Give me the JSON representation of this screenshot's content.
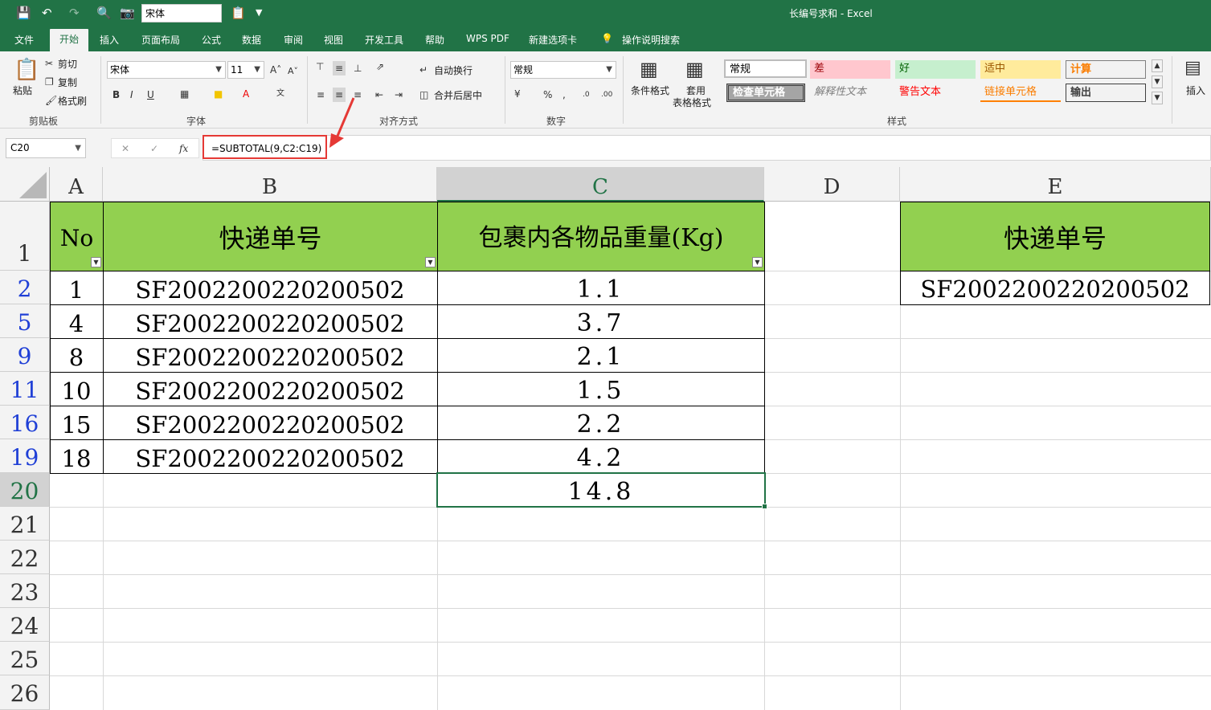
{
  "quick_access": {
    "font_value": "宋体"
  },
  "window_title": "长编号求和  -  Excel",
  "menu": {
    "tabs": [
      "文件",
      "开始",
      "插入",
      "页面布局",
      "公式",
      "数据",
      "审阅",
      "视图",
      "开发工具",
      "帮助",
      "WPS PDF",
      "新建选项卡",
      "操作说明搜索"
    ]
  },
  "ribbon": {
    "clipboard": {
      "paste": "粘贴",
      "cut": "剪切",
      "copy": "复制",
      "format_painter": "格式刷",
      "label": "剪贴板"
    },
    "font": {
      "name": "宋体",
      "size": "11",
      "label": "字体",
      "bold": "B",
      "italic": "I",
      "underline": "U"
    },
    "alignment": {
      "wrap": "自动换行",
      "merge": "合并后居中",
      "label": "对齐方式"
    },
    "number": {
      "format": "常规",
      "label": "数字"
    },
    "styles": {
      "conditional": "条件格式",
      "table_line1": "套用",
      "table_line2": "表格格式",
      "label": "样式",
      "items": [
        "常规",
        "差",
        "好",
        "适中",
        "计算",
        "检查单元格",
        "解释性文本",
        "警告文本",
        "链接单元格",
        "输出"
      ]
    },
    "cells": {
      "insert": "插入"
    }
  },
  "formula_bar": {
    "name_box": "C20",
    "fx": "fx",
    "formula": "=SUBTOTAL(9,C2:C19)"
  },
  "columns": [
    "A",
    "B",
    "C",
    "D",
    "E"
  ],
  "rows": [
    "1",
    "2",
    "5",
    "9",
    "11",
    "16",
    "19",
    "20",
    "21",
    "22",
    "23",
    "24",
    "25",
    "26"
  ],
  "headers": {
    "a": "No",
    "b": "快递单号",
    "c": "包裹内各物品重量(Kg)",
    "e": "快递单号"
  },
  "data_rows": [
    {
      "no": "1",
      "tracking": "SF2002200220200502",
      "weight": "1.1"
    },
    {
      "no": "4",
      "tracking": "SF2002200220200502",
      "weight": "3.7"
    },
    {
      "no": "8",
      "tracking": "SF2002200220200502",
      "weight": "2.1"
    },
    {
      "no": "10",
      "tracking": "SF2002200220200502",
      "weight": "1.5"
    },
    {
      "no": "15",
      "tracking": "SF2002200220200502",
      "weight": "2.2"
    },
    {
      "no": "18",
      "tracking": "SF2002200220200502",
      "weight": "4.2"
    }
  ],
  "total": "14.8",
  "e_value": "SF2002200220200502",
  "colors": {
    "accent": "#217346",
    "header_fill": "#92d050",
    "highlight": "#e53935",
    "row_number_blue": "#1f3fd6"
  }
}
